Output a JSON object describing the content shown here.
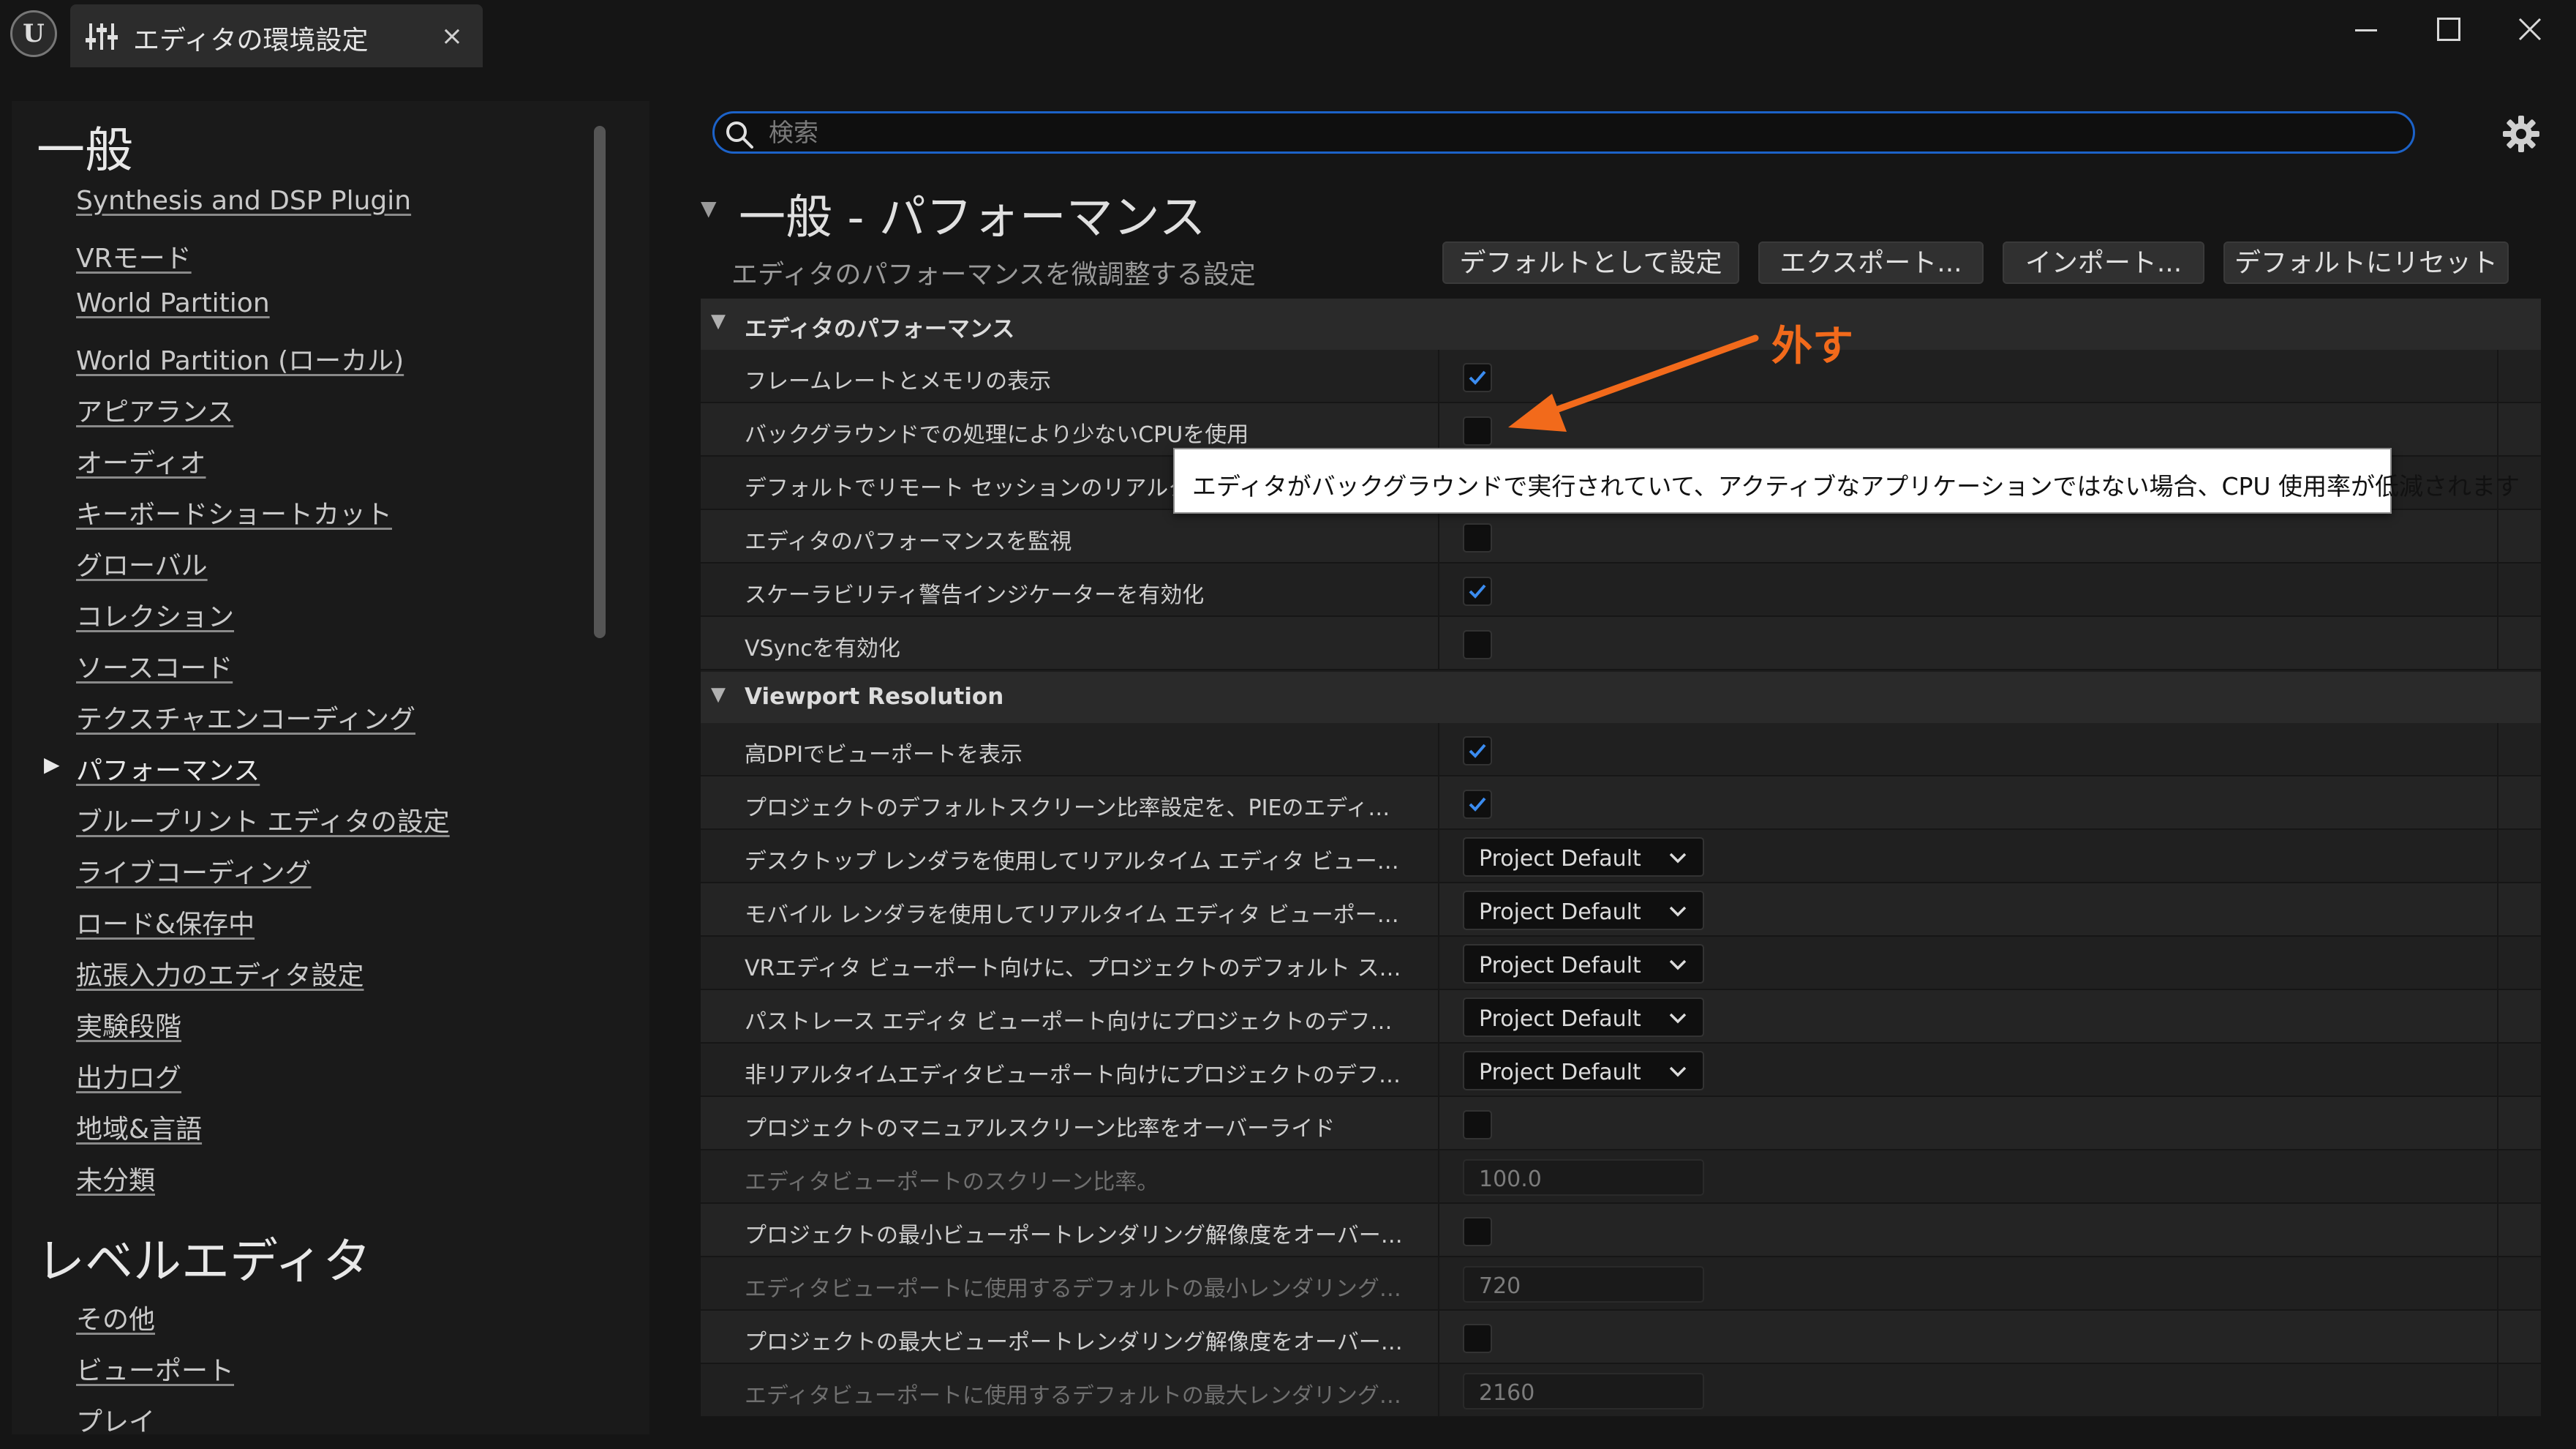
{
  "window": {
    "tab_title": "エディタの環境設定",
    "tab_close": "×"
  },
  "sidebar": {
    "categories": [
      {
        "heading": "一般",
        "items": [
          "Synthesis and DSP Plugin",
          "VRモード",
          "World Partition",
          "World Partition (ローカル)",
          "アピアランス",
          "オーディオ",
          "キーボードショートカット",
          "グローバル",
          "コレクション",
          "ソースコード",
          "テクスチャエンコーディング",
          "パフォーマンス",
          "ブループリント エディタの設定",
          "ライブコーディング",
          "ロード&保存中",
          "拡張入力のエディタ設定",
          "実験段階",
          "出力ログ",
          "地域&言語",
          "未分類"
        ],
        "active_index": 11
      },
      {
        "heading": "レベルエディタ",
        "items": [
          "その他",
          "ビューポート",
          "プレイ"
        ]
      }
    ]
  },
  "search": {
    "placeholder": "検索",
    "value": ""
  },
  "header": {
    "title": "一般 - パフォーマンス",
    "subtitle": "エディタのパフォーマンスを微調整する設定",
    "buttons": {
      "set_default": "デフォルトとして設定",
      "export": "エクスポート...",
      "import": "インポート...",
      "reset": "デフォルトにリセット"
    }
  },
  "groups": {
    "editor_performance": {
      "label": "エディタのパフォーマンス",
      "rows": [
        {
          "label": "フレームレートとメモリの表示",
          "checked": true
        },
        {
          "label": "バックグラウンドでの処理により少ないCPUを使用",
          "checked": false
        },
        {
          "label": "デフォルトでリモート セッションのリアルタイムビューポートを無効化",
          "checked": false
        },
        {
          "label": "エディタのパフォーマンスを監視",
          "checked": false
        },
        {
          "label": "スケーラビリティ警告インジケーターを有効化",
          "checked": true
        },
        {
          "label": "VSyncを有効化",
          "checked": false
        }
      ]
    },
    "viewport_resolution": {
      "label": "Viewport Resolution",
      "rows": [
        {
          "label": "高DPIでビューポートを表示",
          "checked": true
        },
        {
          "label": "プロジェクトのデフォルトスクリーン比率設定を、PIEのエディタビューポートに使用",
          "checked": true
        },
        {
          "label": "デスクトップ レンダラを使用してリアルタイム エディタ ビューポート向けにプロジェクトのデフォルトスクリーン比率",
          "value": "Project Default"
        },
        {
          "label": "モバイル レンダラを使用してリアルタイム エディタ ビューポート向けに、プロジェクトのデフォルトスクリーン比率",
          "value": "Project Default"
        },
        {
          "label": "VRエディタ ビューポート向けに、プロジェクトのデフォルト スクリーン比率設定",
          "value": "Project Default"
        },
        {
          "label": "パストレース エディタ ビューポート向けにプロジェクトのデフォルト スクリーン比率設定",
          "value": "Project Default"
        },
        {
          "label": "非リアルタイムエディタビューポート向けにプロジェクトのデフォルトスクリーン比率設定",
          "value": "Project Default"
        },
        {
          "label": "プロジェクトのマニュアルスクリーン比率をオーバーライド",
          "checked": false
        },
        {
          "label": "エディタビューポートのスクリーン比率。",
          "value": "100.0"
        },
        {
          "label": "プロジェクトの最小ビューポートレンダリング解像度をオーバーライド",
          "checked": false
        },
        {
          "label": "エディタビューポートに使用するデフォルトの最小レンダリング解像度。",
          "value": "720"
        },
        {
          "label": "プロジェクトの最大ビューポートレンダリング解像度をオーバーライド",
          "checked": false
        },
        {
          "label": "エディタビューポートに使用するデフォルトの最大レンダリング解像度。",
          "value": "2160"
        }
      ]
    }
  },
  "tooltip": {
    "text": "エディタがバックグラウンドで実行されていて、アクティブなアプリケーションではない場合、CPU 使用率が低減されます"
  },
  "annotation": {
    "text": "外す",
    "color": "#f26a1b"
  },
  "colors": {
    "accent": "#1c62c8",
    "check": "#3b8cf0"
  },
  "icons": {
    "logo": "unreal-logo-icon",
    "settings_tab": "sliders-icon",
    "search": "search-icon",
    "settings": "gear-icon"
  }
}
